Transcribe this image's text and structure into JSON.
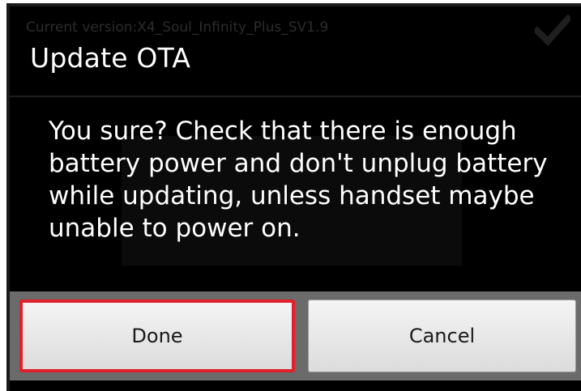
{
  "background": {
    "version_text": "Current version:X4_Soul_Infinity_Plus_SV1.9",
    "status_icon": "checkmark-icon"
  },
  "dialog": {
    "title": "Update OTA",
    "message": "You sure? Check that there is enough battery power and don't unplug battery while updating, unless handset maybe unable to power on.",
    "buttons": {
      "done_label": "Done",
      "cancel_label": "Cancel"
    }
  },
  "colors": {
    "dialog_background": "#000000",
    "text": "#ffffff",
    "button_bar": "#6b6b6b",
    "highlight": "#e0202a"
  }
}
